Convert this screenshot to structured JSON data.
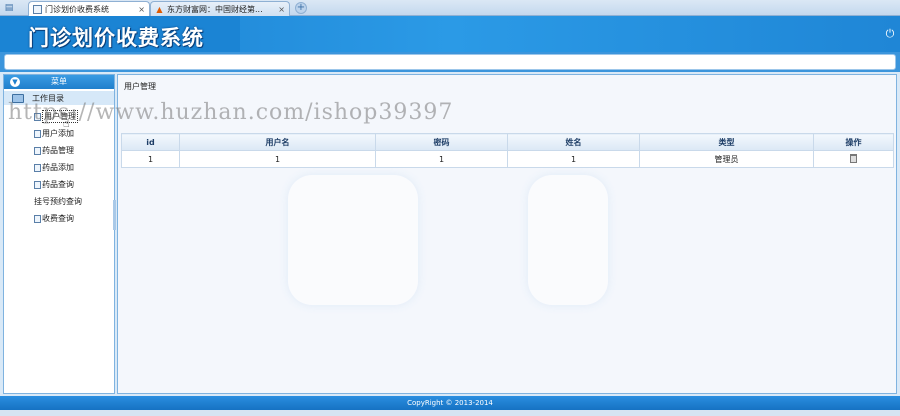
{
  "browser": {
    "tabs": [
      {
        "title": "门诊划价收费系统",
        "active": true
      },
      {
        "title": "东方财富网：中国财经第...",
        "active": false
      }
    ],
    "close_glyph": "×",
    "new_tab_glyph": "+"
  },
  "header": {
    "logo_text": "门诊划价收费系统"
  },
  "sidebar": {
    "menu_title": "菜单",
    "folder_label": "工作目录",
    "items": [
      {
        "label": "用户管理"
      },
      {
        "label": "用户添加"
      },
      {
        "label": "药品管理"
      },
      {
        "label": "药品添加"
      },
      {
        "label": "药品查询"
      },
      {
        "label": "挂号预约查询"
      },
      {
        "label": "收费查询"
      }
    ]
  },
  "main": {
    "breadcrumb": "用户管理",
    "table": {
      "headers": [
        "id",
        "用户名",
        "密码",
        "姓名",
        "类型",
        "操作"
      ],
      "rows": [
        [
          "1",
          "1",
          "1",
          "1",
          "管理员"
        ]
      ]
    }
  },
  "footer": {
    "copyright": "CopyRight © 2013-2014"
  },
  "watermark": "https://www.huzhan.com/ishop39397",
  "colors": {
    "header_blue": "#1f86d6",
    "panel_border": "#7fb3e0",
    "footer_blue": "#1672c3"
  },
  "icons": [
    "menu-icon",
    "favicon-doc",
    "favicon-fire",
    "power-icon",
    "chevron-down-icon",
    "folder-icon",
    "document-icon",
    "trash-icon",
    "cursor-icon"
  ]
}
